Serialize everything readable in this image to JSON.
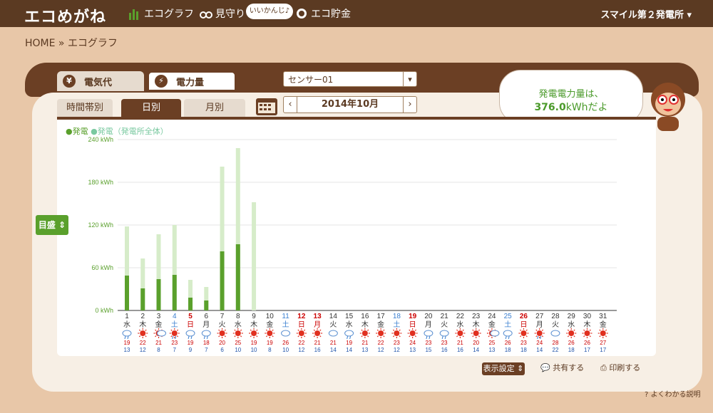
{
  "header": {
    "logo": "エコめがね",
    "nav": [
      {
        "label": "エコグラフ",
        "icon": "bar-graph-icon"
      },
      {
        "label": "見守り",
        "icon": "binoculars-icon"
      },
      {
        "label": "エコ貯金",
        "icon": "coin-icon"
      }
    ],
    "bubble": "いいかんじ♪",
    "plant": "スマイル第２発電所"
  },
  "breadcrumb": "HOME » エコグラフ",
  "tabs": {
    "denki": "電気代",
    "power": "電力量",
    "denki_icon": "¥",
    "power_icon": "⚡"
  },
  "sensor": {
    "value": "センサー01"
  },
  "subtabs": {
    "hourly": "時間帯別",
    "daily": "日別",
    "monthly": "月別"
  },
  "month_nav": {
    "label": "2014年10月",
    "prev": "‹",
    "next": "›"
  },
  "speech": {
    "line1": "発電電力量は、",
    "value": "376.0",
    "unit": "kWhだよ"
  },
  "legend": {
    "a": "●発電",
    "b": "●発電（発電所全体）"
  },
  "scale_button": "目盛",
  "buttons": {
    "display": "表示設定",
    "share": "共有する",
    "print": "印刷する"
  },
  "help": "よくわかる説明",
  "colors": {
    "dark": "#5aa02c",
    "light": "#d6ecc9",
    "brown": "#6b3f24"
  },
  "chart_data": {
    "type": "bar",
    "ylim": [
      0,
      240
    ],
    "yticks": [
      "240 kWh",
      "180 kWh",
      "120 kWh",
      "60 kWh",
      "0 kWh"
    ],
    "days": [
      {
        "d": "1",
        "w": "水",
        "c": "n"
      },
      {
        "d": "2",
        "w": "木",
        "c": "n"
      },
      {
        "d": "3",
        "w": "金",
        "c": "n"
      },
      {
        "d": "4",
        "w": "土",
        "c": "sat"
      },
      {
        "d": "5",
        "w": "日",
        "c": "sun"
      },
      {
        "d": "6",
        "w": "月",
        "c": "n"
      },
      {
        "d": "7",
        "w": "火",
        "c": "n"
      },
      {
        "d": "8",
        "w": "水",
        "c": "n"
      },
      {
        "d": "9",
        "w": "木",
        "c": "n"
      },
      {
        "d": "10",
        "w": "金",
        "c": "n"
      },
      {
        "d": "11",
        "w": "土",
        "c": "sat"
      },
      {
        "d": "12",
        "w": "日",
        "c": "sun"
      },
      {
        "d": "13",
        "w": "月",
        "c": "sun"
      },
      {
        "d": "14",
        "w": "火",
        "c": "n"
      },
      {
        "d": "15",
        "w": "水",
        "c": "n"
      },
      {
        "d": "16",
        "w": "木",
        "c": "n"
      },
      {
        "d": "17",
        "w": "金",
        "c": "n"
      },
      {
        "d": "18",
        "w": "土",
        "c": "sat"
      },
      {
        "d": "19",
        "w": "日",
        "c": "sun"
      },
      {
        "d": "20",
        "w": "月",
        "c": "n"
      },
      {
        "d": "21",
        "w": "火",
        "c": "n"
      },
      {
        "d": "22",
        "w": "水",
        "c": "n"
      },
      {
        "d": "23",
        "w": "木",
        "c": "n"
      },
      {
        "d": "24",
        "w": "金",
        "c": "n"
      },
      {
        "d": "25",
        "w": "土",
        "c": "sat"
      },
      {
        "d": "26",
        "w": "日",
        "c": "sun"
      },
      {
        "d": "27",
        "w": "月",
        "c": "n"
      },
      {
        "d": "28",
        "w": "火",
        "c": "n"
      },
      {
        "d": "29",
        "w": "水",
        "c": "n"
      },
      {
        "d": "30",
        "w": "木",
        "c": "n"
      },
      {
        "d": "31",
        "w": "金",
        "c": "n"
      }
    ],
    "series": [
      {
        "name": "発電",
        "values": [
          49,
          31,
          44,
          50,
          18,
          14,
          83,
          93,
          0,
          0,
          0,
          0,
          0,
          0,
          0,
          0,
          0,
          0,
          0,
          0,
          0,
          0,
          0,
          0,
          0,
          0,
          0,
          0,
          0,
          0,
          0
        ]
      },
      {
        "name": "発電（発電所全体）",
        "values": [
          118,
          73,
          107,
          120,
          43,
          33,
          202,
          228,
          152,
          0,
          0,
          0,
          0,
          0,
          0,
          0,
          0,
          0,
          0,
          0,
          0,
          0,
          0,
          0,
          0,
          0,
          0,
          0,
          0,
          0,
          0
        ]
      }
    ],
    "weather": [
      "cloud-rain",
      "sun",
      "sun-cloud",
      "sun-rain",
      "cloud-rain",
      "cloud-rain",
      "sun",
      "sun",
      "sun",
      "sun",
      "cloud-sun",
      "sun",
      "sun",
      "cloud",
      "cloud-rain",
      "sun",
      "sun",
      "sun",
      "sun",
      "cloud-rain",
      "cloud-rain",
      "sun",
      "sun",
      "sun-cloud",
      "cloud-rain",
      "sun",
      "sun-rain",
      "cloud",
      "sun",
      "sun",
      "sun"
    ],
    "high": [
      "19",
      "22",
      "21",
      "23",
      "19",
      "18",
      "20",
      "25",
      "19",
      "19",
      "26",
      "22",
      "21",
      "21",
      "19",
      "21",
      "22",
      "23",
      "24",
      "23",
      "23",
      "21",
      "20",
      "25",
      "26",
      "23",
      "24",
      "28",
      "26",
      "26",
      "27"
    ],
    "low": [
      "13",
      "12",
      "8",
      "7",
      "9",
      "7",
      "6",
      "10",
      "10",
      "8",
      "10",
      "12",
      "16",
      "14",
      "14",
      "13",
      "12",
      "12",
      "13",
      "15",
      "16",
      "16",
      "14",
      "13",
      "18",
      "18",
      "14",
      "22",
      "18",
      "17",
      "17"
    ]
  }
}
